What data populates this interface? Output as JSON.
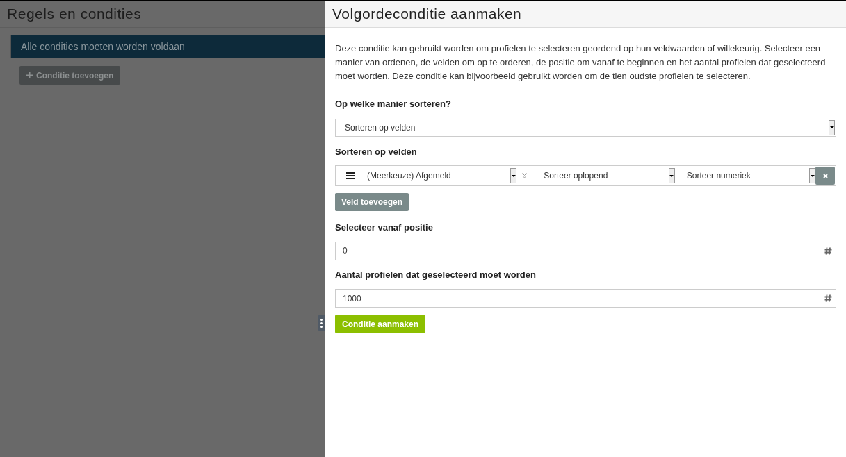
{
  "background": {
    "title": "Regels en condities",
    "rule_bar": "Alle condities moeten worden voldaan",
    "add_button": "Conditie toevoegen"
  },
  "panel": {
    "title": "Volgordeconditie aanmaken",
    "description": "Deze conditie kan gebruikt worden om profielen te selecteren geordend op hun veldwaarden of willekeurig. Selecteer een manier van ordenen, de velden om op te orderen, de positie om vanaf te beginnen en het aantal profielen dat geselecteerd moet worden. Deze conditie kan bijvoorbeeld gebruikt worden om de tien oudste profielen te selecteren.",
    "sort_label": "Op welke manier sorteren?",
    "sort_value": "Sorteren op velden",
    "fields_label": "Sorteren op velden",
    "sort_fields": [
      {
        "field": "(Meerkeuze) Afgemeld",
        "order": "Sorteer oplopend",
        "mode": "Sorteer numeriek"
      }
    ],
    "add_field_button": "Veld toevoegen",
    "start_label": "Selecteer vanaf positie",
    "start_value": "0",
    "count_label": "Aantal profielen dat geselecteerd moet worden",
    "count_value": "1000",
    "submit_button": "Conditie aanmaken"
  }
}
